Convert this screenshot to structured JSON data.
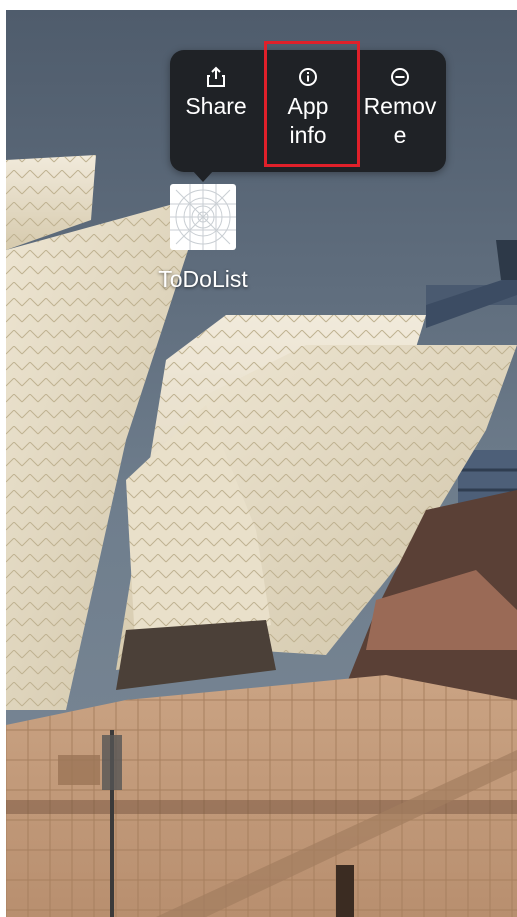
{
  "popup_menu": {
    "items": [
      {
        "label": "Share",
        "icon": "share-icon"
      },
      {
        "label": "App\ninfo",
        "icon": "info-icon"
      },
      {
        "label": "Remov\ne",
        "icon": "remove-icon"
      }
    ],
    "highlighted_item": "App info"
  },
  "app": {
    "name": "ToDoList",
    "icon": "todolist-app-icon"
  },
  "colors": {
    "popup_bg": "#1f2226",
    "highlight": "#e0202a",
    "text": "#ffffff"
  }
}
